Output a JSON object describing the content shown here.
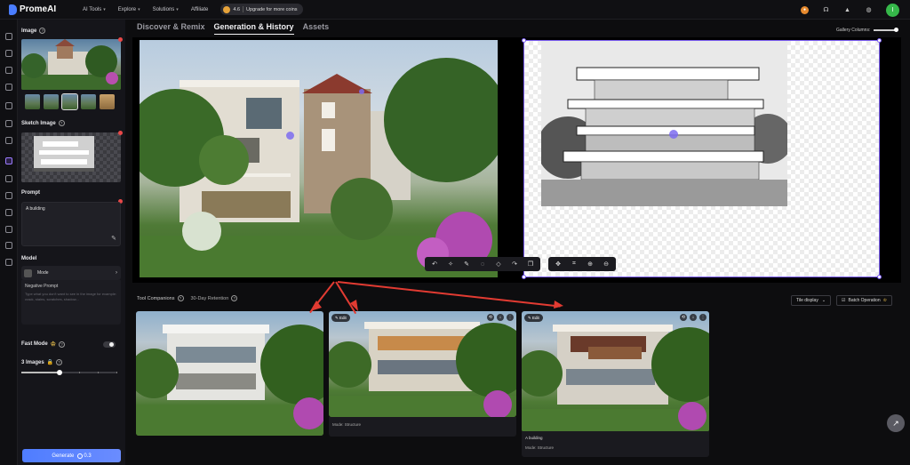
{
  "app": {
    "name": "PromeAI"
  },
  "topnav": {
    "items": [
      {
        "label": "AI Tools",
        "has_menu": true
      },
      {
        "label": "Explore",
        "has_menu": true
      },
      {
        "label": "Solutions",
        "has_menu": true
      },
      {
        "label": "Affiliate",
        "has_menu": false
      }
    ],
    "coins": {
      "value": "4.6",
      "upgrade_label": "Upgrade for more coins"
    },
    "right_icons": [
      "coin-icon",
      "headset-icon",
      "graduation-cap-icon",
      "globe-icon"
    ],
    "avatar_letter": "I"
  },
  "sidebar": {
    "image_label": "Image",
    "sketch_label": "Sketch Image",
    "prompt_label": "Prompt",
    "prompt_value": "A building",
    "model_label": "Model",
    "model_value": "Mode",
    "negative_prompt_label": "Negative Prompt",
    "negative_prompt_placeholder": "Type what you don't want to see in the image for example: crack, stains, scratches, shadow...",
    "fast_mode_label": "Fast Mode",
    "images_label": "3 Images",
    "images_slider_fraction": 0.4,
    "generate_label": "Generate",
    "generate_cost": "0.3"
  },
  "tabs": [
    {
      "label": "Discover & Remix",
      "active": false
    },
    {
      "label": "Generation & History",
      "active": true
    },
    {
      "label": "Assets",
      "active": false
    }
  ],
  "gallery_columns_label": "Gallery Columns:",
  "tool_companions": {
    "label": "Tool Companions",
    "retention": "30-Day Retention"
  },
  "tile_display_label": "Tile display",
  "batch_operation_label": "Batch Operation",
  "cards": [
    {
      "edit_label": "",
      "caption": "",
      "mode": ""
    },
    {
      "edit_label": "Edit",
      "caption": "",
      "mode": "Mode: Structure"
    },
    {
      "edit_label": "Edit",
      "caption": "A building",
      "mode": "Mode: Structure"
    }
  ],
  "colors": {
    "accent": "#4f7dff",
    "selection": "#7a5cf0",
    "annotation_arrow": "#e23b32"
  }
}
